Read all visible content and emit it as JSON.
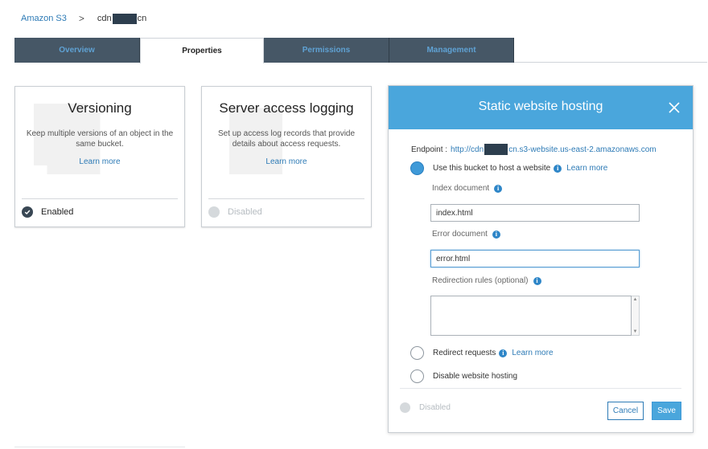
{
  "breadcrumb": {
    "root": "Amazon S3",
    "separator": ">",
    "bucket_prefix": "cdn",
    "bucket_suffix": "cn"
  },
  "tabs": [
    {
      "label": "Overview",
      "active": false
    },
    {
      "label": "Properties",
      "active": true
    },
    {
      "label": "Permissions",
      "active": false
    },
    {
      "label": "Management",
      "active": false
    }
  ],
  "cards": {
    "versioning": {
      "title": "Versioning",
      "description": "Keep multiple versions of an object in the same bucket.",
      "learn_more": "Learn more",
      "status": "Enabled"
    },
    "logging": {
      "title": "Server access logging",
      "description": "Set up access log records that provide details about access requests.",
      "learn_more": "Learn more",
      "status": "Disabled"
    }
  },
  "panel": {
    "title": "Static website hosting",
    "endpoint_label": "Endpoint :",
    "endpoint_prefix": "http://cdn",
    "endpoint_suffix": "cn.s3-website.us-east-2.amazonaws.com",
    "options": {
      "host": {
        "label": "Use this bucket to host a website",
        "learn_more": "Learn more",
        "checked": true
      },
      "redirect": {
        "label": "Redirect requests",
        "learn_more": "Learn more",
        "checked": false
      },
      "disable": {
        "label": "Disable website hosting",
        "checked": false
      }
    },
    "index_label": "Index document",
    "index_value": "index.html",
    "error_label": "Error document",
    "error_value": "error.html",
    "redirection_label": "Redirection rules (optional)",
    "status": "Disabled",
    "cancel_label": "Cancel",
    "save_label": "Save"
  },
  "colors": {
    "accent": "#4aa6dc",
    "tab_dark": "#465766",
    "link": "#2e7bb6"
  },
  "icons": {
    "close": "close-icon",
    "info": "info-icon",
    "check": "check-circle-icon"
  }
}
